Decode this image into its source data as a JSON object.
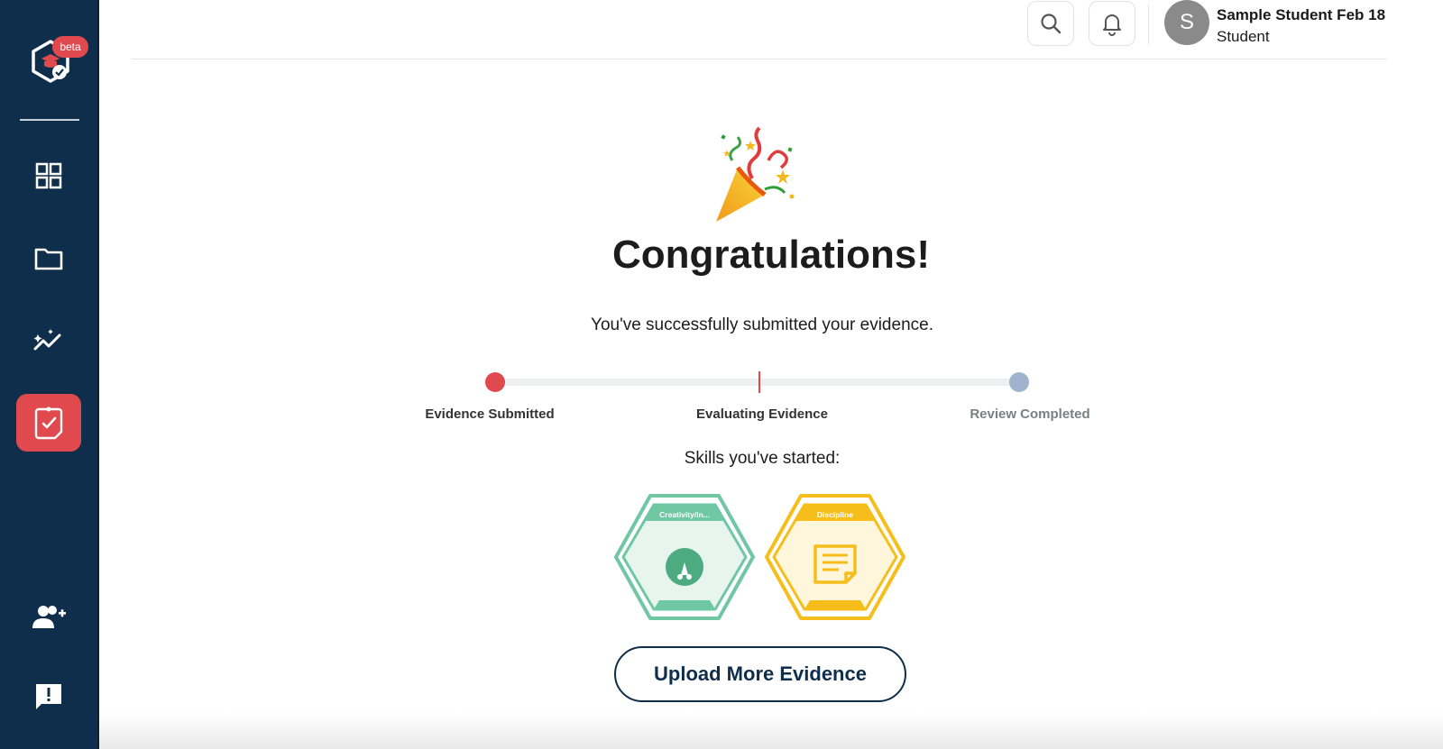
{
  "sidebar": {
    "beta_label": "beta",
    "nav": [
      {
        "icon": "dashboard-grid-icon"
      },
      {
        "icon": "folder-icon"
      },
      {
        "icon": "analytics-sparkle-icon"
      },
      {
        "icon": "evidence-check-icon",
        "active": true
      },
      {
        "icon": "add-user-icon"
      },
      {
        "icon": "feedback-icon"
      }
    ],
    "active_color": "#e04a4f",
    "bg_color": "#0f2e4b"
  },
  "header": {
    "search_icon": "search-icon",
    "bell_icon": "bell-icon",
    "avatar_initial": "S",
    "user_name": "Sample Student Feb 18",
    "user_role": "Student"
  },
  "main": {
    "title": "Congratulations!",
    "subtitle": "You've successfully submitted your evidence.",
    "progress": {
      "steps": [
        "Evidence Submitted",
        "Evaluating Evidence",
        "Review Completed"
      ],
      "current_step": 1
    },
    "skills_heading": "Skills you've started:",
    "skills": [
      {
        "label": "Creativity/In...",
        "color": "#6fc7a3"
      },
      {
        "label": "Discipline",
        "color": "#f6be1b"
      }
    ],
    "upload_button": "Upload More Evidence"
  }
}
